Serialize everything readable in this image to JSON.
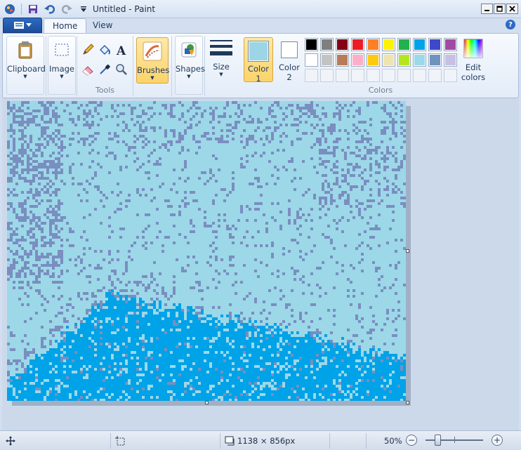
{
  "window": {
    "title": "Untitled - Paint",
    "controls": [
      "minimize",
      "maximize",
      "close"
    ]
  },
  "quick_access": [
    "paint-icon",
    "save-icon",
    "undo-icon",
    "redo-icon",
    "customize-icon"
  ],
  "tabs": [
    {
      "label": "Home",
      "active": true
    },
    {
      "label": "View",
      "active": false
    }
  ],
  "groups": {
    "clipboard": {
      "label": "Clipboard"
    },
    "image": {
      "label": "Image"
    },
    "tools": {
      "label": "Tools",
      "items": [
        "pencil-icon",
        "fill-icon",
        "text-icon",
        "eraser-icon",
        "color-picker-icon",
        "magnifier-icon"
      ]
    },
    "brushes": {
      "label": "Brushes"
    },
    "shapes": {
      "label": "Shapes"
    },
    "size": {
      "label": "Size"
    },
    "color1": {
      "label1": "Color",
      "label2": "1",
      "color": "#9cd6e6"
    },
    "color2": {
      "label1": "Color",
      "label2": "2",
      "color": "#ffffff"
    },
    "colors": {
      "label": "Colors",
      "row1": [
        "#000000",
        "#7f7f7f",
        "#880015",
        "#ed1c24",
        "#ff7f27",
        "#fff200",
        "#22b14c",
        "#00a2e8",
        "#3f48cc",
        "#a349a4"
      ],
      "row2": [
        "#ffffff",
        "#c3c3c3",
        "#b97a57",
        "#ffaec9",
        "#ffc90e",
        "#efe4b0",
        "#b5e61d",
        "#99d9ea",
        "#7092be",
        "#c8bfe7"
      ],
      "row3": [
        "",
        "",
        "",
        "",
        "",
        "",
        "",
        "",
        "",
        ""
      ]
    },
    "edit_colors": {
      "label1": "Edit",
      "label2": "colors"
    }
  },
  "canvas": {
    "light_color": "#9cd8e8",
    "dark_color": "#00a2e8",
    "speckle_color": "#7a8ec0"
  },
  "status": {
    "image_size": "1138 × 856px",
    "zoom": "50%",
    "zoom_out": "−",
    "zoom_in": "+"
  }
}
